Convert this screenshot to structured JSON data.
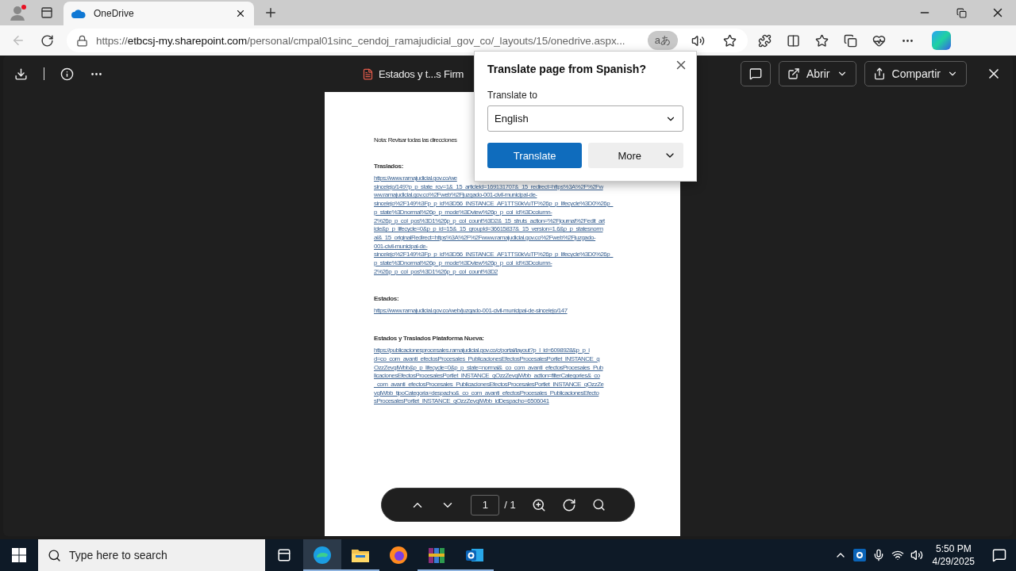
{
  "browser": {
    "tabs": [
      {
        "title": "OneDrive",
        "selected": true
      }
    ],
    "url": {
      "scheme": "https://",
      "host": "etbcsj-my.sharepoint.com",
      "path": "/personal/cmpal01sinc_cendoj_ramajudicial_gov_co/_layouts/15/onedrive.aspx..."
    },
    "translate_chip": "aあ"
  },
  "viewer": {
    "file_name": "Estados y t...s Firm",
    "open_button": "Abrir",
    "share_button": "Compartir"
  },
  "document": {
    "blocks": [
      {
        "kind": "note",
        "text": "Nota: Revisar todas las direcciones"
      },
      {
        "kind": "heading",
        "text": "Traslados:"
      },
      {
        "kind": "link",
        "lines": [
          "https://www.ramajudicial.gov.co/we",
          "sincelejo/149?p_p_state_rcv=1&_15_articleId=169131707&_15_redirect=https%3A%2F%2Fw",
          "ww.ramajudicial.gov.co%2Fweb%2Fjuzgado-001-civil-municipal-de-",
          "sincelejo%2F149%3Fp_p_id%3D56_INSTANCE_AF1TTS0kVuTF%26p_p_lifecycle%3D0%26p_",
          "p_state%3Dnormal%26p_p_mode%3Dview%26p_p_col_id%3Dcolumn-",
          "2%26p_p_col_pos%3D1%26p_p_col_count%3D2&_15_struts_action=%2Fjournal%2Fedit_art",
          "icle&p_p_lifecycle=0&p_p_id=15&_15_groupId=36615837&_15_version=1.6&p_p_statesnorm",
          "al&_15_originalRedirect=https%3A%2F%2Fwww.ramajudicial.gov.co%2Fweb%2Fjuzgado-",
          "001-civil-municipal-de-",
          "sincelejo%2F149%3Fp_p_id%3D56_INSTANCE_AF1TTS0kVuTF%26p_p_lifecycle%3D0%26p_",
          "p_state%3Dnormal%26p_p_mode%3Dview%26p_p_col_id%3Dcolumn-",
          "2%26p_p_col_pos%3D1%26p_p_col_count%3D2"
        ]
      },
      {
        "kind": "heading",
        "text": "Estados:"
      },
      {
        "kind": "link",
        "lines": [
          "https://www.ramajudicial.gov.co/web/juzgado-001-civil-municipal-de-sincelejo/147"
        ]
      },
      {
        "kind": "heading",
        "text": "Estados y Traslados Plataforma Nueva:"
      },
      {
        "kind": "link",
        "lines": [
          "https://publicacionesprocesales.ramajudicial.gov.co/c/portal/layout?p_l_id=6098928&p_p_i",
          "d=co_com_avanti_efectosProcesales_PublicacionesEfectosProcesalesPortlet_INSTANCE_q",
          "OzzZevqIWbb&p_p_lifecycle=0&p_p_state=normal&_co_com_avanti_efectosProcesales_Pub",
          "licacionesEfectosProcesalesPortlet_INSTANCE_qOzzZevqIWbb_action=filterCategories&_co",
          "_com_avanti_efectosProcesales_PublicacionesEfectosProcesalesPortlet_INSTANCE_qOzzZe",
          "vqIWbb_tipoCategoria=despacho&_co_com_avanti_efectosProcesales_PublicacionesEfecto",
          "sProcesalesPortlet_INSTANCE_qOzzZevqIWbb_idDespacho=6506041"
        ]
      }
    ]
  },
  "pager": {
    "page": "1",
    "total": "/ 1"
  },
  "translate_popup": {
    "title": "Translate page from Spanish?",
    "label": "Translate to",
    "language": "English",
    "translate_button": "Translate",
    "more_button": "More"
  },
  "taskbar": {
    "search_placeholder": "Type here to search",
    "apps": [
      {
        "kind": "edge",
        "selected": true,
        "running": true
      },
      {
        "kind": "explorer",
        "selected": false,
        "running": true
      },
      {
        "kind": "firefox",
        "selected": false,
        "running": false
      },
      {
        "kind": "winrar",
        "selected": false,
        "running": true
      },
      {
        "kind": "outlook",
        "selected": false,
        "running": true
      }
    ],
    "time": "5:50 PM",
    "date": "4/29/2025"
  }
}
